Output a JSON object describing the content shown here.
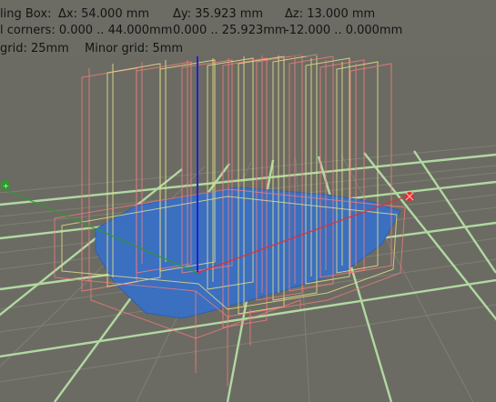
{
  "bounding_box": {
    "label": "ling Box:",
    "dx": "Δx: 54.000 mm",
    "dy": "Δy: 35.923 mm",
    "dz": "Δz: 13.000 mm"
  },
  "corners": {
    "label": "l corners: 0.000 .. 44.000mm",
    "y_range": "0.000 .. 25.923mm",
    "z_range": "-12.000 .. 0.000mm"
  },
  "grid": {
    "major": "grid: 25mm",
    "minor": "Minor grid: 5mm"
  },
  "colors": {
    "background": "#6b6b63",
    "grid_major": "#b9e6a8",
    "grid_minor": "#8f8f83",
    "mesh_fill": "#3b6fc0",
    "wire_red": "#f07a7a",
    "wire_yellow": "#e8e08a",
    "axis_x": "#e03030",
    "axis_y": "#2e9a2e",
    "axis_z": "#2222cc"
  },
  "icons": [
    "x-axis-marker-icon",
    "y-axis-marker-icon",
    "z-axis-line-icon"
  ]
}
